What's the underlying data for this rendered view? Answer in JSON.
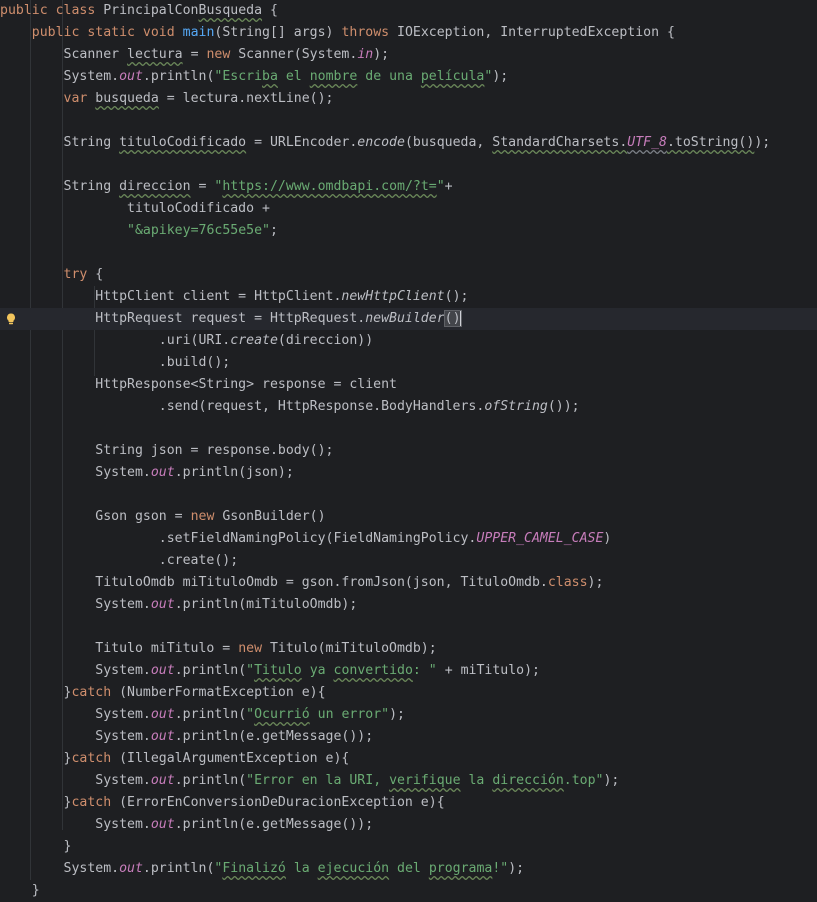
{
  "editor": {
    "lines": [
      [
        [
          "kw",
          "public "
        ],
        [
          "kw",
          "class "
        ],
        [
          "p",
          "PrincipalCon"
        ],
        [
          "pu",
          "Busqueda"
        ],
        [
          "p",
          " {"
        ]
      ],
      [
        [
          "p",
          "    "
        ],
        [
          "kw",
          "public "
        ],
        [
          "kw",
          "static "
        ],
        [
          "kw",
          "void "
        ],
        [
          "fn",
          "main"
        ],
        [
          "p",
          "(String[] args) "
        ],
        [
          "kw",
          "throws "
        ],
        [
          "p",
          "IOException, InterruptedException {"
        ]
      ],
      [
        [
          "p",
          "        Scanner "
        ],
        [
          "pu",
          "lectura"
        ],
        [
          "p",
          " = "
        ],
        [
          "kw",
          "new "
        ],
        [
          "p",
          "Scanner(System."
        ],
        [
          "st",
          "in"
        ],
        [
          "p",
          ");"
        ]
      ],
      [
        [
          "p",
          "        System."
        ],
        [
          "st",
          "out"
        ],
        [
          "p",
          ".println("
        ],
        [
          "s",
          "\"Escri"
        ],
        [
          "su",
          "ba"
        ],
        [
          "s",
          " el "
        ],
        [
          "su",
          "nombre"
        ],
        [
          "s",
          " de una "
        ],
        [
          "su",
          "película"
        ],
        [
          "s",
          "\""
        ],
        [
          "p",
          ");"
        ]
      ],
      [
        [
          "kw",
          "        var "
        ],
        [
          "pu",
          "busqueda"
        ],
        [
          "p",
          " = lectura.nextLine();"
        ]
      ],
      [
        [
          "p",
          ""
        ]
      ],
      [
        [
          "p",
          "        String "
        ],
        [
          "pu",
          "tituloCodificado"
        ],
        [
          "p",
          " = URLEncoder."
        ],
        [
          "it",
          "encode"
        ],
        [
          "p",
          "(busqueda, "
        ],
        [
          "pu",
          "StandardCharsets."
        ],
        [
          "stu",
          "UTF_8"
        ],
        [
          "pu",
          ".toString()"
        ],
        [
          "p",
          ");"
        ]
      ],
      [
        [
          "p",
          ""
        ]
      ],
      [
        [
          "p",
          "        String "
        ],
        [
          "pu",
          "direccion"
        ],
        [
          "p",
          " = "
        ],
        [
          "s",
          "\""
        ],
        [
          "su",
          "https://www.omdbapi.com/?t="
        ],
        [
          "s",
          "\""
        ],
        [
          "p",
          "+"
        ]
      ],
      [
        [
          "p",
          "                tituloCodificado +"
        ]
      ],
      [
        [
          "p",
          "                "
        ],
        [
          "s",
          "\"&apikey=76c55e5e\""
        ],
        [
          "p",
          ";"
        ]
      ],
      [
        [
          "p",
          ""
        ]
      ],
      [
        [
          "kw",
          "        try "
        ],
        [
          "p",
          "{"
        ]
      ],
      [
        [
          "p",
          "            HttpClient client = HttpClient."
        ],
        [
          "it",
          "newHttpClient"
        ],
        [
          "p",
          "();"
        ]
      ],
      [
        [
          "p",
          "            HttpRequest request = HttpRequest."
        ],
        [
          "it",
          "newBuilder"
        ],
        [
          "bh",
          "()"
        ],
        [
          "caret",
          ""
        ]
      ],
      [
        [
          "p",
          "                    .uri(URI."
        ],
        [
          "it",
          "create"
        ],
        [
          "p",
          "(direccion))"
        ]
      ],
      [
        [
          "p",
          "                    .build();"
        ]
      ],
      [
        [
          "p",
          "            HttpResponse<String> response = client"
        ]
      ],
      [
        [
          "p",
          "                    .send(request, HttpResponse.BodyHandlers."
        ],
        [
          "it",
          "ofString"
        ],
        [
          "p",
          "());"
        ]
      ],
      [
        [
          "p",
          ""
        ]
      ],
      [
        [
          "p",
          "            String json = response.body();"
        ]
      ],
      [
        [
          "p",
          "            System."
        ],
        [
          "st",
          "out"
        ],
        [
          "p",
          ".println(json);"
        ]
      ],
      [
        [
          "p",
          ""
        ]
      ],
      [
        [
          "p",
          "            Gson gson = "
        ],
        [
          "kw",
          "new "
        ],
        [
          "p",
          "GsonBuilder()"
        ]
      ],
      [
        [
          "p",
          "                    .setFieldNamingPolicy(FieldNamingPolicy."
        ],
        [
          "st",
          "UPPER_CAMEL_CASE"
        ],
        [
          "p",
          ")"
        ]
      ],
      [
        [
          "p",
          "                    .create();"
        ]
      ],
      [
        [
          "p",
          "            TituloOmdb miTituloOmdb = gson.fromJson(json, TituloOmdb."
        ],
        [
          "kw",
          "class"
        ],
        [
          "p",
          ");"
        ]
      ],
      [
        [
          "p",
          "            System."
        ],
        [
          "st",
          "out"
        ],
        [
          "p",
          ".println(miTituloOmdb);"
        ]
      ],
      [
        [
          "p",
          ""
        ]
      ],
      [
        [
          "p",
          "            Titulo miTitulo = "
        ],
        [
          "kw",
          "new "
        ],
        [
          "p",
          "Titulo(miTituloOmdb);"
        ]
      ],
      [
        [
          "p",
          "            System."
        ],
        [
          "st",
          "out"
        ],
        [
          "p",
          ".println("
        ],
        [
          "s",
          "\""
        ],
        [
          "su",
          "Titulo"
        ],
        [
          "s",
          " ya "
        ],
        [
          "su",
          "convertido"
        ],
        [
          "s",
          ": \""
        ],
        [
          "p",
          " + miTitulo);"
        ]
      ],
      [
        [
          "p",
          "        }"
        ],
        [
          "kw",
          "catch "
        ],
        [
          "p",
          "(NumberFormatException e){"
        ]
      ],
      [
        [
          "p",
          "            System."
        ],
        [
          "st",
          "out"
        ],
        [
          "p",
          ".println("
        ],
        [
          "s",
          "\""
        ],
        [
          "su",
          "Ocurrió"
        ],
        [
          "s",
          " un error\""
        ],
        [
          "p",
          ");"
        ]
      ],
      [
        [
          "p",
          "            System."
        ],
        [
          "st",
          "out"
        ],
        [
          "p",
          ".println(e.getMessage());"
        ]
      ],
      [
        [
          "p",
          "        }"
        ],
        [
          "kw",
          "catch "
        ],
        [
          "p",
          "(IllegalArgumentException e){"
        ]
      ],
      [
        [
          "p",
          "            System."
        ],
        [
          "st",
          "out"
        ],
        [
          "p",
          ".println("
        ],
        [
          "s",
          "\"Error en la URI, "
        ],
        [
          "su",
          "verifique"
        ],
        [
          "s",
          " la "
        ],
        [
          "su",
          "dirección"
        ],
        [
          "s",
          ".top\""
        ],
        [
          "p",
          ");"
        ]
      ],
      [
        [
          "p",
          "        }"
        ],
        [
          "kw",
          "catch "
        ],
        [
          "p",
          "(ErrorEnConversionDeDuracionException e){"
        ]
      ],
      [
        [
          "p",
          "            System."
        ],
        [
          "st",
          "out"
        ],
        [
          "p",
          ".println(e.getMessage());"
        ]
      ],
      [
        [
          "p",
          "        }"
        ]
      ],
      [
        [
          "p",
          "        System."
        ],
        [
          "st",
          "out"
        ],
        [
          "p",
          ".println("
        ],
        [
          "s",
          "\""
        ],
        [
          "su",
          "Finalizó"
        ],
        [
          "s",
          " la "
        ],
        [
          "su",
          "ejecución"
        ],
        [
          "s",
          " del "
        ],
        [
          "su",
          "programa"
        ],
        [
          "s",
          "!\""
        ],
        [
          "p",
          ");"
        ]
      ],
      [
        [
          "p",
          "    }"
        ]
      ]
    ],
    "caret_line_index": 14,
    "gutter_icons": [
      {
        "line_index": 14,
        "icon": "lightbulb-icon"
      }
    ]
  },
  "colors": {
    "background": "#1e1f22",
    "keyword": "#cf8e6d",
    "string": "#6aab73",
    "function": "#56a8f5",
    "static_field": "#c77dbb",
    "text": "#bcbec4",
    "bulb": "#f2c55c"
  }
}
